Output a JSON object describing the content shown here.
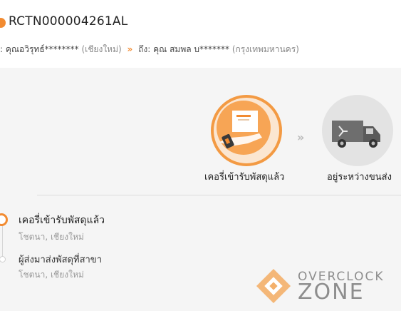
{
  "header": {
    "tracking_number": "RCTN000004261AL",
    "from_prefix": ":",
    "from_name": "คุณอวิรุทธ์********",
    "from_province": "(เชียงใหม่)",
    "arrow": "»",
    "to_prefix": "ถึง:",
    "to_name": "คุณ สมพล บ*******",
    "to_province": "(กรุงเทพมหานคร)"
  },
  "steps": [
    {
      "label": "เคอรี่เข้ารับพัสดุแล้ว",
      "icon": "courier-received-icon",
      "state": "active"
    },
    {
      "label": "อยู่ระหว่างขนส่ง",
      "icon": "truck-icon",
      "state": "pending"
    }
  ],
  "step_separator": "»",
  "timeline": [
    {
      "title": "เคอรี่เข้ารับพัสดุแล้ว",
      "location": "โชตนา, เชียงใหม่",
      "state": "active"
    },
    {
      "title": "ผู้ส่งมาส่งพัสดุที่สาขา",
      "location": "โชตนา, เชียงใหม่",
      "state": "done"
    }
  ],
  "watermark": {
    "line1": "OVERCLOCK",
    "line2": "ZONE"
  },
  "colors": {
    "accent": "#f28b31",
    "background": "#f5f5f5"
  }
}
